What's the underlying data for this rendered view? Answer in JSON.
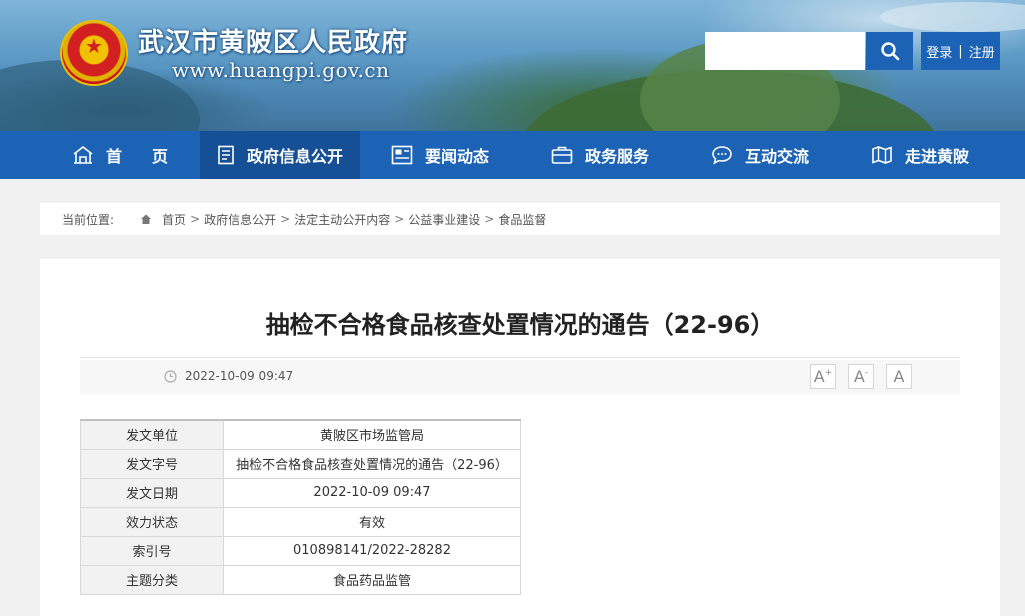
{
  "header": {
    "site_title": "武汉市黄陂区人民政府",
    "site_url": "www.huangpi.gov.cn",
    "search": {
      "placeholder": ""
    },
    "login_label": "登录",
    "separator": "|",
    "register_label": "注册"
  },
  "nav": [
    {
      "label": "首页",
      "icon": "home-icon",
      "active": false
    },
    {
      "label": "政府信息公开",
      "icon": "document-icon",
      "active": true
    },
    {
      "label": "要闻动态",
      "icon": "news-icon",
      "active": false
    },
    {
      "label": "政务服务",
      "icon": "briefcase-icon",
      "active": false
    },
    {
      "label": "互动交流",
      "icon": "chat-icon",
      "active": false
    },
    {
      "label": "走进黄陂",
      "icon": "map-icon",
      "active": false
    }
  ],
  "breadcrumb": {
    "current_label": "当前位置:",
    "items": [
      "首页",
      "政府信息公开",
      "法定主动公开内容",
      "公益事业建设",
      "食品监督"
    ],
    "separator": ">"
  },
  "article": {
    "title": "抽检不合格食品核查处置情况的通告（22-96）",
    "date": "2022-10-09 09:47",
    "font_buttons": [
      "A",
      "A",
      "A"
    ]
  },
  "info_table": [
    {
      "key": "发文单位",
      "value": "黄陂区市场监管局"
    },
    {
      "key": "发文字号",
      "value": "抽检不合格食品核查处置情况的通告（22-96）"
    },
    {
      "key": "发文日期",
      "value": "2022-10-09 09:47"
    },
    {
      "key": "效力状态",
      "value": "有效"
    },
    {
      "key": "索引号",
      "value": "010898141/2022-28282"
    },
    {
      "key": "主题分类",
      "value": "食品药品监管"
    }
  ],
  "colors": {
    "brand": "#1d63b5",
    "nav_active": "#154f96"
  }
}
